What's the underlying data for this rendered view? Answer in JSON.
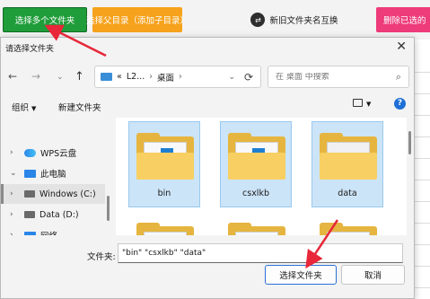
{
  "app_toolbar": {
    "select_folders_label": "选择多个文件夹",
    "select_parent_label": "选择父目录（添加子目录）",
    "swap_label": "新旧文件夹名互换",
    "delete_label": "删除已选的"
  },
  "dialog": {
    "title": "请选择文件夹",
    "close_glyph": "✕",
    "nav": {
      "back_glyph": "←",
      "forward_glyph": "→",
      "dropdown_glyph": "⌄",
      "up_glyph": "↑"
    },
    "address": {
      "prefix": "«",
      "segments": [
        "L2...",
        "桌面"
      ],
      "separator": "›",
      "trailing_separator": "›",
      "chevron_glyph": "⌄",
      "refresh_glyph": "⟳"
    },
    "search": {
      "placeholder": "在 桌面 中搜索",
      "icon_glyph": "⌕"
    },
    "toolbar": {
      "organize_label": "组织",
      "organize_arrow": "▼",
      "new_folder_label": "新建文件夹",
      "view_arrow": "▼",
      "help_glyph": "?"
    },
    "tree": [
      {
        "label": "WPS云盘",
        "icon": "cloud-icon",
        "chevron": "›"
      },
      {
        "label": "此电脑",
        "icon": "pc-icon",
        "chevron": "⌄"
      },
      {
        "label": "Windows (C:)",
        "icon": "drive-icon",
        "chevron": "›",
        "selected": true
      },
      {
        "label": "Data (D:)",
        "icon": "drive-icon",
        "chevron": "›"
      },
      {
        "label": "网络",
        "icon": "network-icon",
        "chevron": "›"
      }
    ],
    "folders": [
      {
        "name": "bin",
        "selected": true
      },
      {
        "name": "csxlkb",
        "selected": true
      },
      {
        "name": "data",
        "selected": true
      },
      {
        "name": "",
        "selected": false
      },
      {
        "name": "",
        "selected": false
      },
      {
        "name": "",
        "selected": false
      }
    ],
    "filename_label": "文件夹:",
    "filename_value": "\"bin\" \"csxlkb\" \"data\"",
    "ok_label": "选择文件夹",
    "cancel_label": "取消"
  },
  "colors": {
    "green_button": "#1f9d3a",
    "orange_button": "#f6a21c",
    "pink_button": "#ee3b7a",
    "selection": "#cce4f7",
    "arrow": "#e8273a",
    "accent_blue": "#2a6fd6"
  }
}
